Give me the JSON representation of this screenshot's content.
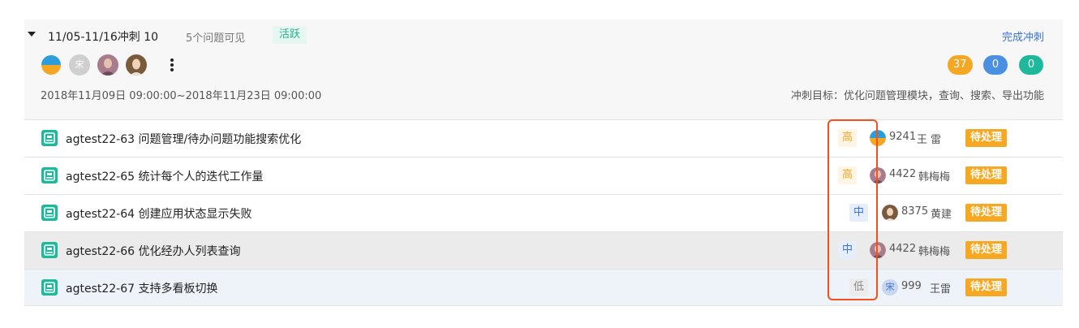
{
  "sprint": {
    "name": "11/05-11/16冲刺 10",
    "visible_count": "5个问题可见",
    "state_badge": "活跃",
    "complete_action": "完成冲刺",
    "date_range": "2018年11月09日 09:00:00~2018年11月23日 09:00:00",
    "goal": "冲刺目标：优化问题管理模块，查询、搜索、导出功能",
    "member_avatars": [
      {
        "icon": "pinwheel-avatar",
        "text": ""
      },
      {
        "icon": "initial-avatar",
        "text": "宋"
      },
      {
        "icon": "photo-avatar",
        "text": ""
      },
      {
        "icon": "photo-avatar",
        "text": ""
      }
    ],
    "counts": [
      {
        "value": "37",
        "color": "#f5a623"
      },
      {
        "value": "0",
        "color": "#4a90e2"
      },
      {
        "value": "0",
        "color": "#1fb89a"
      }
    ]
  },
  "issues": [
    {
      "key_title": "agtest22-63 问题管理/待办问题功能搜索优化",
      "priority": "高",
      "priority_level": "high",
      "assignee_id": "9241",
      "assignee_name": "王 雷",
      "status": "待处理",
      "row_bg": "#ffffff"
    },
    {
      "key_title": "agtest22-65 统计每个人的迭代工作量",
      "priority": "高",
      "priority_level": "high",
      "assignee_id": "4422",
      "assignee_name": "韩梅梅",
      "status": "待处理",
      "row_bg": "#ffffff"
    },
    {
      "key_title": "agtest22-64 创建应用状态显示失败",
      "priority": "中",
      "priority_level": "mid",
      "assignee_id": "8375",
      "assignee_name": "黄建",
      "status": "待处理",
      "row_bg": "#ffffff"
    },
    {
      "key_title": "agtest22-66 优化经办人列表查询",
      "priority": "中",
      "priority_level": "mid",
      "assignee_id": "4422",
      "assignee_name": "韩梅梅",
      "status": "待处理",
      "row_bg": "#ebebeb"
    },
    {
      "key_title": "agtest22-67 支持多看板切换",
      "priority": "低",
      "priority_level": "low",
      "assignee_id": "999",
      "assignee_name": "王雷",
      "assignee_initial": "宋",
      "status": "待处理",
      "row_bg": "#edf3f9"
    }
  ],
  "colors": {
    "accent_blue": "#3b73d4",
    "status_orange": "#f7a823",
    "active_green": "#22b38a",
    "highlight_red": "#f4501e"
  }
}
